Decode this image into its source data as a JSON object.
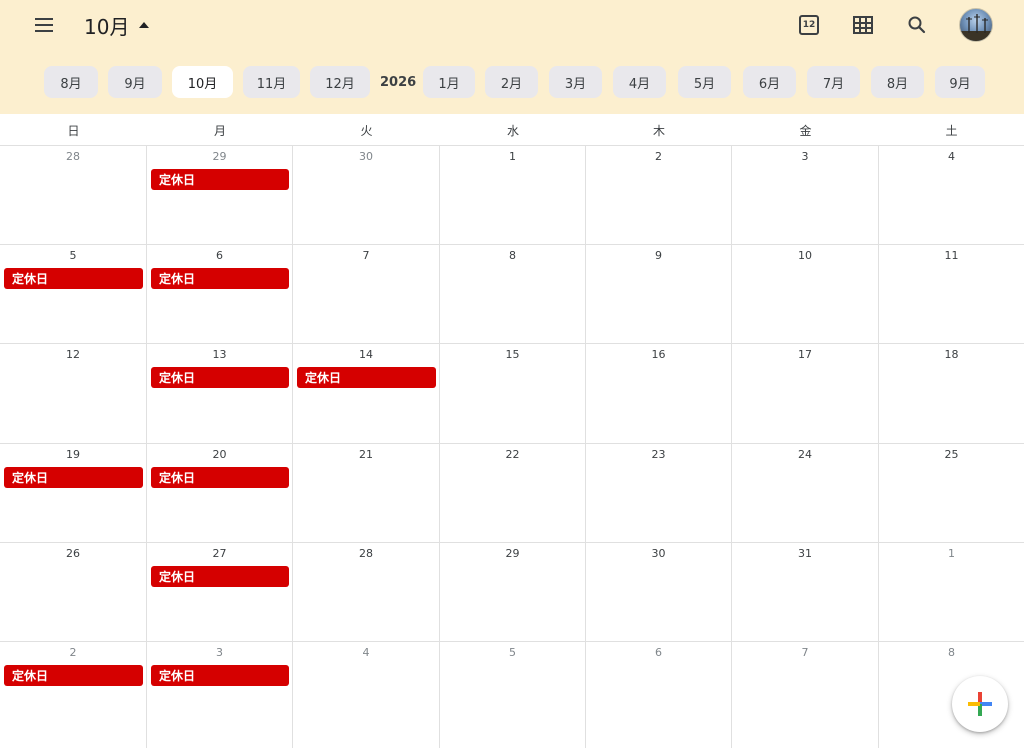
{
  "header": {
    "month_title": "10月",
    "today_icon_text": "12",
    "icons": {
      "menu": "menu-icon",
      "today": "calendar-today-icon",
      "view": "grid-view-icon",
      "search": "search-icon",
      "avatar": "avatar"
    }
  },
  "month_strip": {
    "months_before": [
      "8月",
      "9月",
      "10月",
      "11月",
      "12月"
    ],
    "year_label": "2026",
    "months_after": [
      "1月",
      "2月",
      "3月",
      "4月",
      "5月",
      "6月",
      "7月",
      "8月",
      "9月"
    ],
    "active": "10月"
  },
  "weekdays": [
    "日",
    "月",
    "火",
    "水",
    "木",
    "金",
    "土"
  ],
  "weeks": [
    [
      {
        "d": "28",
        "other": true,
        "event": ""
      },
      {
        "d": "29",
        "other": true,
        "event": "定休日"
      },
      {
        "d": "30",
        "other": true,
        "event": ""
      },
      {
        "d": "1",
        "other": false,
        "event": ""
      },
      {
        "d": "2",
        "other": false,
        "event": ""
      },
      {
        "d": "3",
        "other": false,
        "event": ""
      },
      {
        "d": "4",
        "other": false,
        "event": ""
      }
    ],
    [
      {
        "d": "5",
        "other": false,
        "event": "定休日"
      },
      {
        "d": "6",
        "other": false,
        "event": "定休日"
      },
      {
        "d": "7",
        "other": false,
        "event": ""
      },
      {
        "d": "8",
        "other": false,
        "event": ""
      },
      {
        "d": "9",
        "other": false,
        "event": ""
      },
      {
        "d": "10",
        "other": false,
        "event": ""
      },
      {
        "d": "11",
        "other": false,
        "event": ""
      }
    ],
    [
      {
        "d": "12",
        "other": false,
        "event": ""
      },
      {
        "d": "13",
        "other": false,
        "event": "定休日"
      },
      {
        "d": "14",
        "other": false,
        "event": "定休日"
      },
      {
        "d": "15",
        "other": false,
        "event": ""
      },
      {
        "d": "16",
        "other": false,
        "event": ""
      },
      {
        "d": "17",
        "other": false,
        "event": ""
      },
      {
        "d": "18",
        "other": false,
        "event": ""
      }
    ],
    [
      {
        "d": "19",
        "other": false,
        "event": "定休日"
      },
      {
        "d": "20",
        "other": false,
        "event": "定休日"
      },
      {
        "d": "21",
        "other": false,
        "event": ""
      },
      {
        "d": "22",
        "other": false,
        "event": ""
      },
      {
        "d": "23",
        "other": false,
        "event": ""
      },
      {
        "d": "24",
        "other": false,
        "event": ""
      },
      {
        "d": "25",
        "other": false,
        "event": ""
      }
    ],
    [
      {
        "d": "26",
        "other": false,
        "event": ""
      },
      {
        "d": "27",
        "other": false,
        "event": "定休日"
      },
      {
        "d": "28",
        "other": false,
        "event": ""
      },
      {
        "d": "29",
        "other": false,
        "event": ""
      },
      {
        "d": "30",
        "other": false,
        "event": ""
      },
      {
        "d": "31",
        "other": false,
        "event": ""
      },
      {
        "d": "1",
        "other": true,
        "event": ""
      }
    ],
    [
      {
        "d": "2",
        "other": true,
        "event": "定休日"
      },
      {
        "d": "3",
        "other": true,
        "event": "定休日"
      },
      {
        "d": "4",
        "other": true,
        "event": ""
      },
      {
        "d": "5",
        "other": true,
        "event": ""
      },
      {
        "d": "6",
        "other": true,
        "event": ""
      },
      {
        "d": "7",
        "other": true,
        "event": ""
      },
      {
        "d": "8",
        "other": true,
        "event": ""
      }
    ]
  ],
  "fab": {
    "icon": "plus-icon"
  },
  "colors": {
    "header_bg": "#fcefcf",
    "event": "#d50000",
    "pill_bg": "#e9e8ec"
  }
}
